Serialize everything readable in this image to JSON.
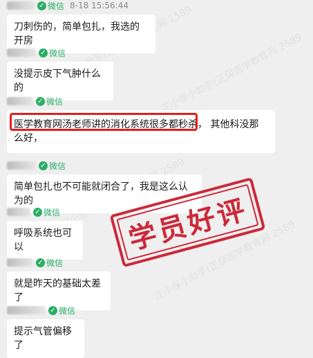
{
  "watermark": "正小保小助手(正保医学教育网 2589",
  "stamp_text": "学员好评",
  "wechat_label": "微信",
  "messages": [
    {
      "time": "8-18 15:56:44",
      "text": "刀刺伤的，简单包扎，我选的开房"
    },
    {
      "time": "",
      "text": "没提示皮下气肿什么的"
    },
    {
      "time": "",
      "text": "医学教育网汤老师讲的消化系统很多都秒杀，  其他科没那么好，"
    },
    {
      "time": "",
      "text": "简单包扎也不可能就闭合了，我是这么认为的"
    },
    {
      "time": "",
      "text": "呼吸系统也可以"
    },
    {
      "time": "",
      "text": "就是昨天的基础太差了"
    },
    {
      "time": "",
      "text": "提示气管偏移了"
    }
  ]
}
